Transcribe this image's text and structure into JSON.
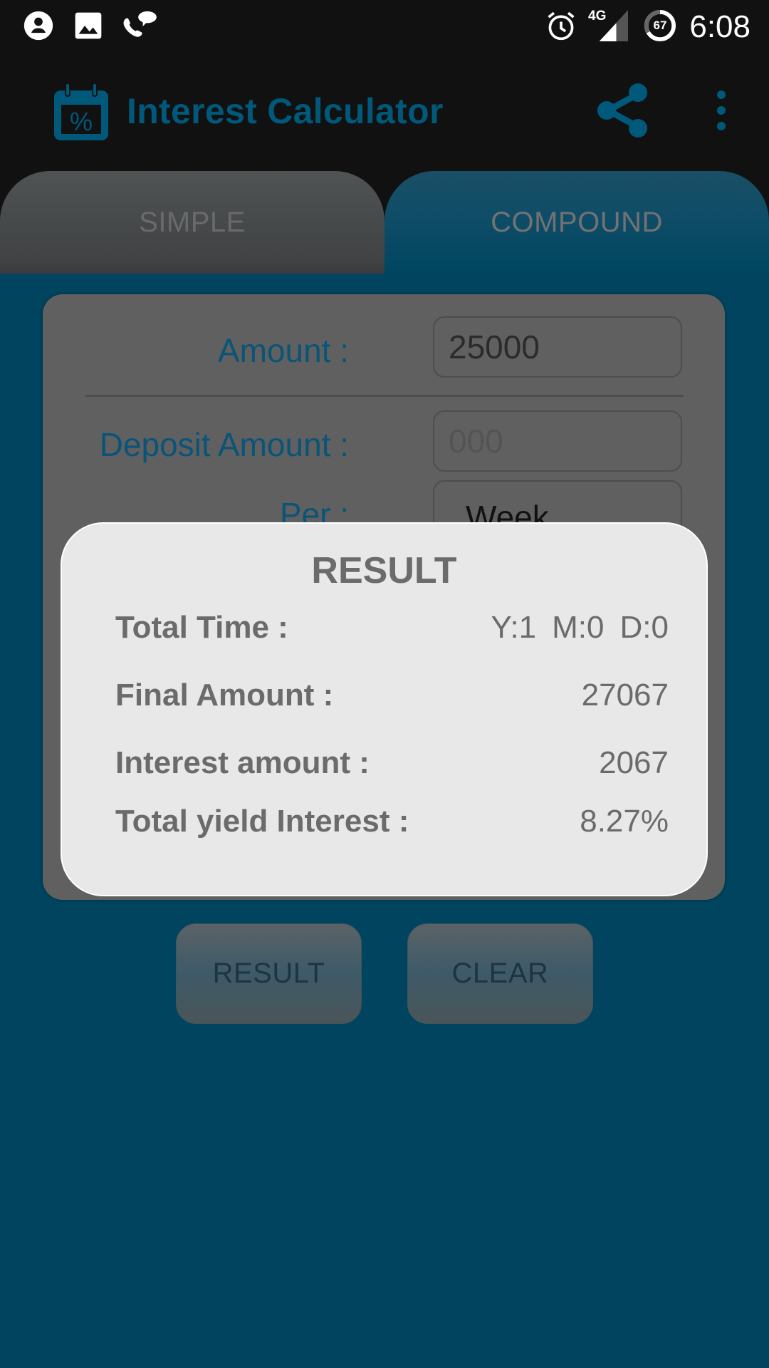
{
  "status_bar": {
    "time": "6:08",
    "network": "4G",
    "battery_percent": "67",
    "left_icons": [
      "account-icon",
      "image-icon",
      "call-message-icon"
    ],
    "right_icons": [
      "alarm-icon",
      "signal-4g-icon",
      "battery-icon"
    ]
  },
  "app_bar": {
    "title": "Interest Calculator",
    "logo_glyph": "%",
    "accent_color": "#00587a"
  },
  "tabs": [
    {
      "label": "SIMPLE",
      "selected": false
    },
    {
      "label": "COMPOUND",
      "selected": true
    }
  ],
  "form": {
    "amount": {
      "label": "Amount :",
      "value": "25000"
    },
    "deposit": {
      "label": "Deposit Amount :",
      "placeholder": "000",
      "value": ""
    },
    "per": {
      "label": "Per :",
      "value": "Week"
    }
  },
  "buttons": {
    "result": "RESULT",
    "clear": "CLEAR"
  },
  "result_dialog": {
    "title": "RESULT",
    "rows": [
      {
        "label": "Total Time :",
        "years": "Y:1",
        "months": "M:0",
        "days": "D:0"
      },
      {
        "label": "Final Amount :",
        "value": "27067"
      },
      {
        "label": "Interest amount :",
        "value": "2067"
      },
      {
        "label": "Total yield Interest :",
        "value": "8.27%"
      }
    ]
  },
  "colors": {
    "background": "#00445f",
    "bar": "#111111",
    "dialog": "#e8e8e8",
    "card": "#606060"
  }
}
